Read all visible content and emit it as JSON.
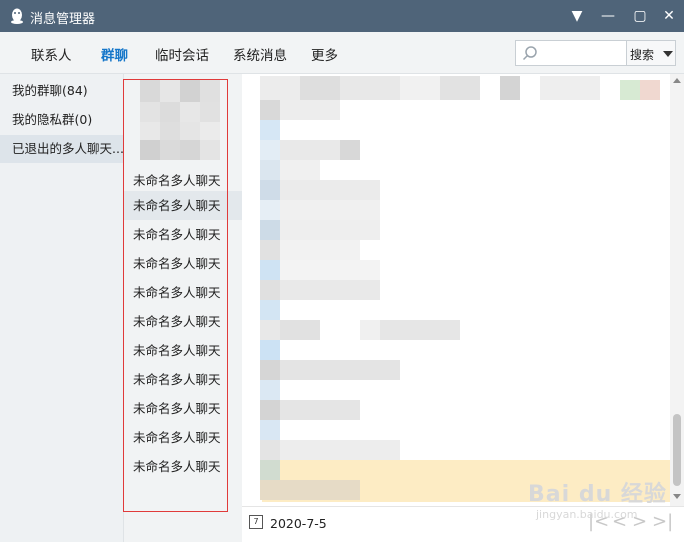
{
  "window": {
    "title": "消息管理器",
    "menu_glyph": "▼",
    "min_glyph": "—",
    "max_glyph": "▢",
    "close_glyph": "✕"
  },
  "tabs": [
    {
      "label": "联系人",
      "active": false
    },
    {
      "label": "群聊",
      "active": true
    },
    {
      "label": "临时会话",
      "active": false
    },
    {
      "label": "系统消息",
      "active": false
    },
    {
      "label": "更多",
      "active": false
    }
  ],
  "search": {
    "value": "",
    "placeholder": "",
    "button_label": "搜索",
    "icon": "search-icon"
  },
  "sidebar": {
    "items": [
      {
        "label": "我的群聊(84)"
      },
      {
        "label": "我的隐私群(0)"
      },
      {
        "label": "已退出的多人聊天..."
      }
    ],
    "selected_index": 2
  },
  "group_list": {
    "items": [
      {
        "label": "未命名多人聊天"
      },
      {
        "label": "未命名多人聊天"
      },
      {
        "label": "未命名多人聊天"
      },
      {
        "label": "未命名多人聊天"
      },
      {
        "label": "未命名多人聊天"
      },
      {
        "label": "未命名多人聊天"
      },
      {
        "label": "未命名多人聊天"
      },
      {
        "label": "未命名多人聊天"
      },
      {
        "label": "未命名多人聊天"
      },
      {
        "label": "未命名多人聊天"
      },
      {
        "label": "未命名多人聊天"
      }
    ]
  },
  "footer": {
    "date": "2020-7-5",
    "calendar_icon": "calendar-icon",
    "nav_first": "|<",
    "nav_prev": "<",
    "nav_next": ">",
    "nav_last": ">|"
  },
  "watermark": {
    "main": "Bai du 经验",
    "sub": "jingyan.baidu.com"
  },
  "colors": {
    "titlebar": "#4f6479",
    "active_tab": "#1576c9",
    "highlight_row": "#fdecc4",
    "annotation_box": "#e03a3a"
  }
}
